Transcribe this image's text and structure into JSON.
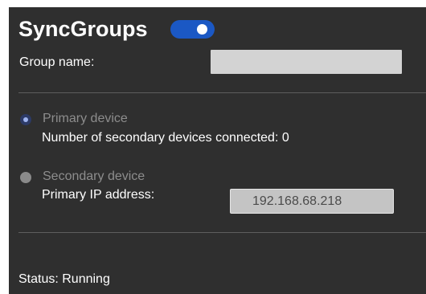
{
  "header": {
    "title": "SyncGroups",
    "toggle_enabled": true,
    "toggle_color": "#1b58c4"
  },
  "group": {
    "label": "Group name:",
    "value": ""
  },
  "primary": {
    "label": "Primary device",
    "selected": true,
    "info_label": "Number of secondary devices connected:",
    "count": "0",
    "info_text": "Number of secondary devices connected: 0"
  },
  "secondary": {
    "label": "Secondary device",
    "selected": false,
    "ip_label": "Primary IP address:",
    "ip_value": "192.168.68.218"
  },
  "status": {
    "text": "Status: Running"
  },
  "colors": {
    "panel_bg": "#2f2f2f",
    "accent": "#1b58c4",
    "disabled_text": "#8d8d8d"
  }
}
